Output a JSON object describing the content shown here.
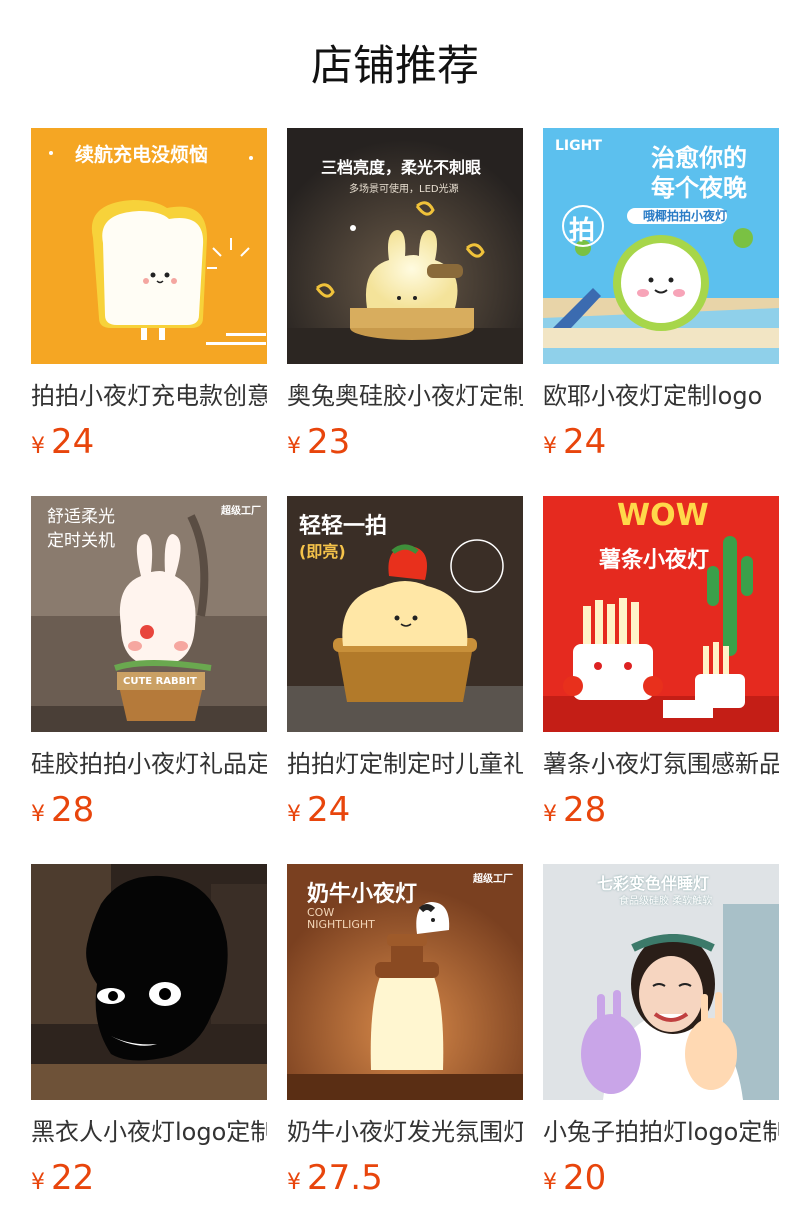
{
  "page": {
    "title": "店铺推荐"
  },
  "products": [
    {
      "name": "拍拍小夜灯充电款创意",
      "currency": "¥",
      "price": "24",
      "image": {
        "icon": "toast-lamp-image",
        "bg": "#f6a91c",
        "headline": "续航充电没烦恼",
        "sub": ""
      }
    },
    {
      "name": "奥兔奥硅胶小夜灯定制",
      "currency": "¥",
      "price": "23",
      "image": {
        "icon": "bunny-lamp-image",
        "bg": "#3c3632",
        "headline": "三档亮度，柔光不刺眼",
        "sub": "多场景可使用，LED光源"
      }
    },
    {
      "name": "欧耶小夜灯定制logo",
      "currency": "¥",
      "price": "24",
      "image": {
        "icon": "coconut-lamp-image",
        "bg": "#4cb6e8",
        "headline": "治愈你的",
        "headline2": "每个夜晚",
        "badge": "哦椰拍拍小夜灯",
        "corner": "LIGHT",
        "pai": "拍"
      }
    },
    {
      "name": "硅胶拍拍小夜灯礼品定",
      "currency": "¥",
      "price": "28",
      "image": {
        "icon": "rabbit-plant-lamp-image",
        "bg": "#5e5147",
        "headline": "舒适柔光",
        "headline2": "定时关机",
        "brand": "超级工厂",
        "pot_text": "CUTE RABBIT"
      }
    },
    {
      "name": "拍拍灯定制定时儿童礼",
      "currency": "¥",
      "price": "24",
      "image": {
        "icon": "cake-lamp-image",
        "bg": "#3d2f24",
        "headline": "轻轻一拍",
        "headline2": "(即亮)"
      }
    },
    {
      "name": "薯条小夜灯氛围感新品",
      "currency": "¥",
      "price": "28",
      "image": {
        "icon": "fries-lamp-image",
        "bg": "#e8231c",
        "headline": "WOW",
        "headline2": "薯条小夜灯"
      }
    },
    {
      "name": "黑衣人小夜灯logo定制",
      "currency": "¥",
      "price": "22",
      "image": {
        "icon": "black-head-lamp-image",
        "bg": "#2c221d"
      }
    },
    {
      "name": "奶牛小夜灯发光氛围灯",
      "currency": "¥",
      "price": "27.5",
      "image": {
        "icon": "cow-lamp-image",
        "bg": "#8a4e2a",
        "headline": "奶牛小夜灯",
        "sub": "COW",
        "sub2": "NIGHTLIGHT",
        "brand": "超级工厂"
      }
    },
    {
      "name": "小兔子拍拍灯logo定制",
      "currency": "¥",
      "price": "20",
      "image": {
        "icon": "bunny-girl-lamp-image",
        "bg": "#dfe3e6",
        "headline": "七彩变色伴睡灯",
        "sub": "食品级硅胶  柔软触软"
      }
    }
  ]
}
